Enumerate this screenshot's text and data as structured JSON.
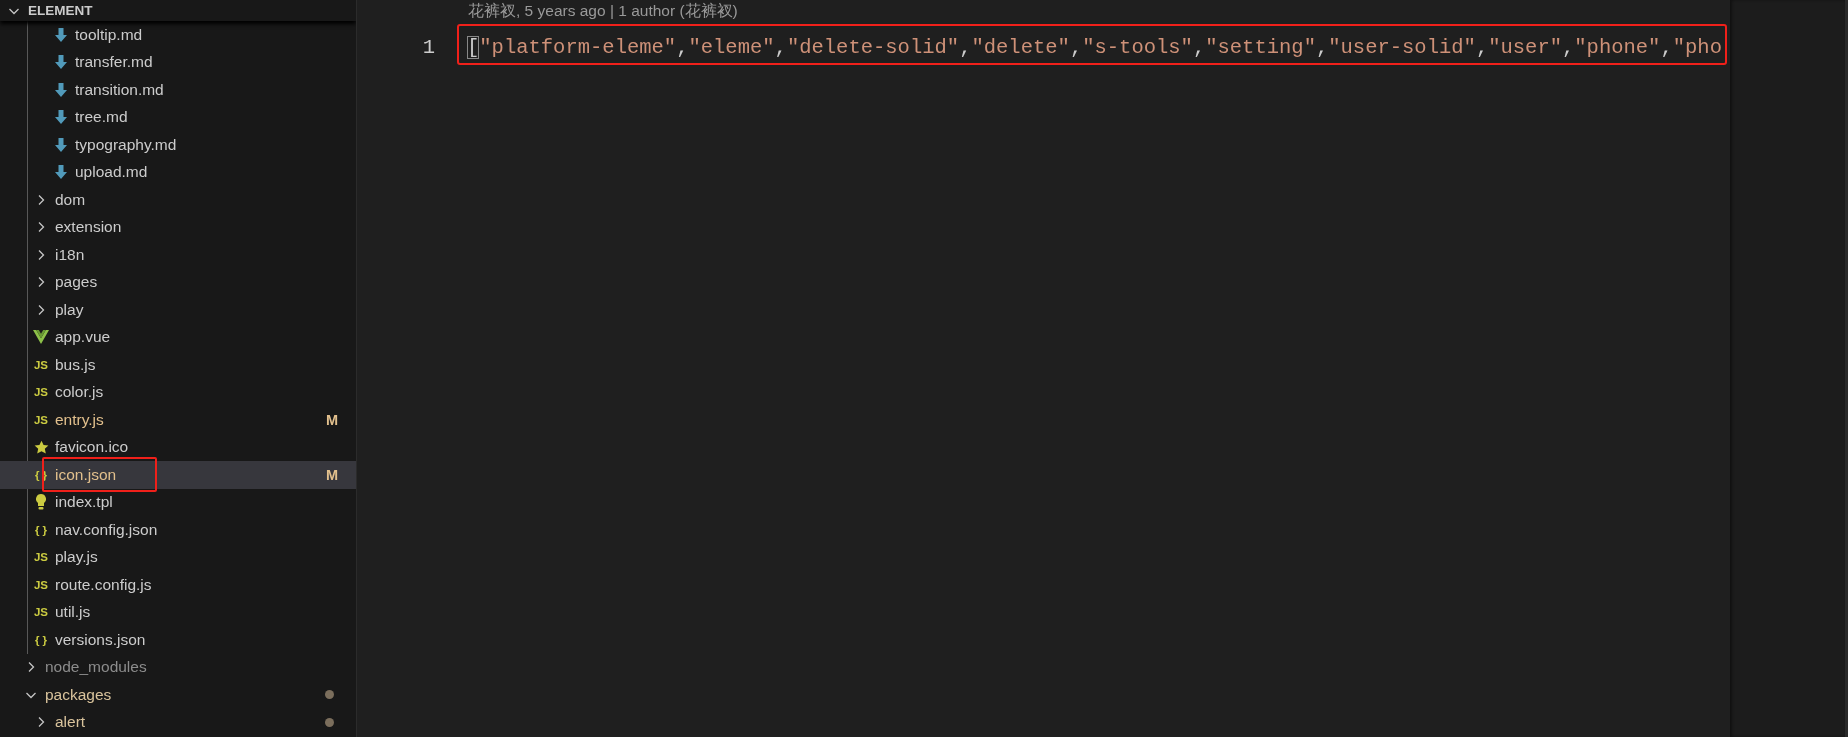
{
  "explorer": {
    "title": "ELEMENT",
    "expanded": true,
    "tree": [
      {
        "children": [
          {
            "children": [
              {
                "children": [
                  {
                    "label": "tooltip.md",
                    "kind": "markdown",
                    "selected": false,
                    "highlighted": false,
                    "modified": false
                  },
                  {
                    "label": "transfer.md",
                    "kind": "markdown",
                    "selected": false,
                    "highlighted": false,
                    "modified": false
                  },
                  {
                    "label": "transition.md",
                    "kind": "markdown",
                    "selected": false,
                    "highlighted": false,
                    "modified": false
                  },
                  {
                    "label": "tree.md",
                    "kind": "markdown",
                    "selected": false,
                    "highlighted": false,
                    "modified": false
                  },
                  {
                    "label": "typography.md",
                    "kind": "markdown",
                    "selected": false,
                    "highlighted": false,
                    "modified": false
                  },
                  {
                    "label": "upload.md",
                    "kind": "markdown",
                    "selected": false,
                    "highlighted": false,
                    "modified": false
                  }
                ]
              }
            ]
          },
          {
            "label": "dom",
            "kind": "folder",
            "expanded": false,
            "selected": false,
            "highlighted": false,
            "modified": false,
            "ignored": false,
            "changes_inside": false
          },
          {
            "label": "extension",
            "kind": "folder",
            "expanded": false,
            "selected": false,
            "highlighted": false,
            "modified": false,
            "ignored": false,
            "changes_inside": false
          },
          {
            "label": "i18n",
            "kind": "folder",
            "expanded": false,
            "selected": false,
            "highlighted": false,
            "modified": false,
            "ignored": false,
            "changes_inside": false
          },
          {
            "label": "pages",
            "kind": "folder",
            "expanded": false,
            "selected": false,
            "highlighted": false,
            "modified": false,
            "ignored": false,
            "changes_inside": false
          },
          {
            "label": "play",
            "kind": "folder",
            "expanded": false,
            "selected": false,
            "highlighted": false,
            "modified": false,
            "ignored": false,
            "changes_inside": false
          },
          {
            "label": "app.vue",
            "kind": "vue",
            "selected": false,
            "highlighted": false,
            "modified": false
          },
          {
            "label": "bus.js",
            "kind": "js",
            "icon_text": "JS",
            "selected": false,
            "highlighted": false,
            "modified": false
          },
          {
            "label": "color.js",
            "kind": "js",
            "icon_text": "JS",
            "selected": false,
            "highlighted": false,
            "modified": false
          },
          {
            "label": "entry.js",
            "kind": "js",
            "icon_text": "JS",
            "selected": false,
            "highlighted": false,
            "modified": true,
            "decoration": "M"
          },
          {
            "label": "favicon.ico",
            "kind": "favicon",
            "selected": false,
            "highlighted": false,
            "modified": false
          },
          {
            "label": "icon.json",
            "kind": "json",
            "icon_text": "{ }",
            "selected": true,
            "highlighted": true,
            "modified": true,
            "decoration": "M"
          },
          {
            "label": "index.tpl",
            "kind": "template",
            "selected": false,
            "highlighted": false,
            "modified": false
          },
          {
            "label": "nav.config.json",
            "kind": "json",
            "icon_text": "{ }",
            "selected": false,
            "highlighted": false,
            "modified": false
          },
          {
            "label": "play.js",
            "kind": "js",
            "icon_text": "JS",
            "selected": false,
            "highlighted": false,
            "modified": false
          },
          {
            "label": "route.config.js",
            "kind": "js",
            "icon_text": "JS",
            "selected": false,
            "highlighted": false,
            "modified": false
          },
          {
            "label": "util.js",
            "kind": "js",
            "icon_text": "JS",
            "selected": false,
            "highlighted": false,
            "modified": false
          },
          {
            "label": "versions.json",
            "kind": "json",
            "icon_text": "{ }",
            "selected": false,
            "highlighted": false,
            "modified": false
          }
        ]
      },
      {
        "label": "node_modules",
        "kind": "folder",
        "expanded": false,
        "selected": false,
        "highlighted": false,
        "modified": false,
        "ignored": true,
        "changes_inside": false
      },
      {
        "label": "packages",
        "kind": "folder",
        "expanded": true,
        "selected": false,
        "highlighted": false,
        "modified": false,
        "ignored": false,
        "changes_inside": true,
        "children": [
          {
            "label": "alert",
            "kind": "folder",
            "expanded": false,
            "selected": false,
            "highlighted": false,
            "modified": false,
            "ignored": false,
            "changes_inside": true
          }
        ]
      }
    ]
  },
  "editor": {
    "blame": "花裤衩, 5 years ago | 1 author (花裤衩)",
    "lines": [
      {
        "number": "1",
        "highlighted": true,
        "tokens": [
          {
            "text": "[",
            "kind": "bracket-match"
          },
          {
            "text": "\"platform-eleme\"",
            "kind": "string"
          },
          {
            "text": ",",
            "kind": "punct"
          },
          {
            "text": "\"eleme\"",
            "kind": "string"
          },
          {
            "text": ",",
            "kind": "punct"
          },
          {
            "text": "\"delete-solid\"",
            "kind": "string"
          },
          {
            "text": ",",
            "kind": "punct"
          },
          {
            "text": "\"delete\"",
            "kind": "string"
          },
          {
            "text": ",",
            "kind": "punct"
          },
          {
            "text": "\"s-tools\"",
            "kind": "string"
          },
          {
            "text": ",",
            "kind": "punct"
          },
          {
            "text": "\"setting\"",
            "kind": "string"
          },
          {
            "text": ",",
            "kind": "punct"
          },
          {
            "text": "\"user-solid\"",
            "kind": "string"
          },
          {
            "text": ",",
            "kind": "punct"
          },
          {
            "text": "\"user\"",
            "kind": "string"
          },
          {
            "text": ",",
            "kind": "punct"
          },
          {
            "text": "\"phone\"",
            "kind": "string"
          },
          {
            "text": ",",
            "kind": "punct"
          },
          {
            "text": "\"pho",
            "kind": "string"
          }
        ]
      }
    ]
  }
}
